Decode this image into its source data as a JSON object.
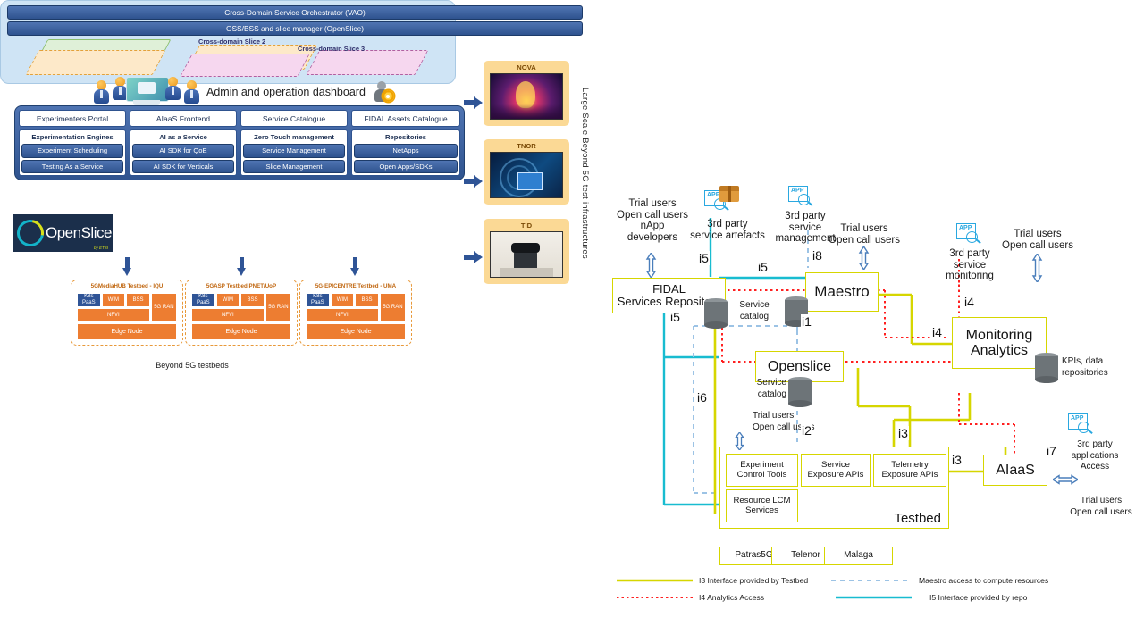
{
  "left_panel": {
    "dashboard_title": "Admin and operation dashboard",
    "top_blocks": [
      {
        "header": "Experimenters Portal",
        "group_title": "Experimentation Engines",
        "items": [
          "Experiment Scheduling",
          "Testing As a Service"
        ]
      },
      {
        "header": "AIaaS Frontend",
        "group_title": "AI as a Service",
        "items": [
          "AI SDK for QoE",
          "AI SDK for Verticals"
        ]
      },
      {
        "header": "Service Catalogue",
        "group_title": "Zero Touch management",
        "items": [
          "Service Management",
          "Slice Management"
        ]
      },
      {
        "header": "FIDAL Assets Catalogue",
        "group_title": "Repositories",
        "items": [
          "NetApps",
          "Open Apps/SDKs"
        ]
      }
    ],
    "orchestrator_bar": "Cross-Domain Service  Orchestrator (VAO)",
    "ossbss_bar": "OSS/BSS and slice manager (OpenSlice)",
    "slice_labels": [
      "Cross-domain Slice 2",
      "Cross-domain Slice 3"
    ],
    "openslice_logo": {
      "text": "OpenSlice",
      "sub": "by ETSI"
    },
    "testbeds": [
      {
        "title": "5GMediaHUB Testbed - IQU",
        "rows": [
          "K8s PaaS",
          "WIM",
          "BSS",
          "5G RAN",
          "NFVI",
          "Edge Node"
        ]
      },
      {
        "title": "5GASP Testbed PNET/UoP",
        "rows": [
          "K8s PaaS",
          "WIM",
          "BSS",
          "5G RAN",
          "NFVI",
          "Edge Node"
        ]
      },
      {
        "title": "5G-EPICENTRE Testbed - UMA",
        "rows": [
          "K8s PaaS",
          "WIM",
          "BSS",
          "5G RAN",
          "NFVI",
          "Edge Node"
        ]
      }
    ],
    "testbeds_caption": "Beyond 5G testbeds",
    "infrastructures": [
      {
        "name": "NOVA"
      },
      {
        "name": "TNOR"
      },
      {
        "name": "TID"
      }
    ],
    "infrastructures_caption": "Large Scale Beyond 5G test infrastructures"
  },
  "right_panel": {
    "boxes": {
      "fidal": "FIDAL\nServices Repository",
      "fidal_l1": "FIDAL",
      "fidal_l2": "Services Repository",
      "maestro": "Maestro",
      "openslice": "Openslice",
      "monitoring_l1": "Monitoring",
      "monitoring_l2": "Analytics",
      "aiaas": "AIaaS",
      "testbed": "Testbed",
      "experiment_control_l1": "Experiment",
      "experiment_control_l2": "Control Tools",
      "service_exposure_l1": "Service",
      "service_exposure_l2": "Exposure APIs",
      "telemetry_l1": "Telemetry",
      "telemetry_l2": "Exposure APIs",
      "resource_lcm_l1": "Resource LCM",
      "resource_lcm_l2": "Services"
    },
    "testbed_sites": [
      "Patras5G",
      "Telenor",
      "Malaga"
    ],
    "actors": [
      {
        "id": "trial-nappdev",
        "lines": [
          "Trial users",
          "Open call users",
          "nApp",
          "developers"
        ],
        "icon": "user-icon"
      },
      {
        "id": "third-party-artefacts",
        "lines": [
          "3rd party",
          "service artefacts"
        ],
        "icon": "app-search-icon"
      },
      {
        "id": "third-party-mgmt",
        "lines": [
          "3rd party",
          "service",
          "management"
        ],
        "icon": "app-search-icon"
      },
      {
        "id": "trial-maestro",
        "lines": [
          "Trial users",
          "Open call users"
        ],
        "icon": "user-icon"
      },
      {
        "id": "third-party-monitoring",
        "lines": [
          "3rd party",
          "service",
          "monitoring"
        ],
        "icon": "app-search-icon"
      },
      {
        "id": "trial-monitoring",
        "lines": [
          "Trial users",
          "Open call users"
        ],
        "icon": "user-icon"
      },
      {
        "id": "trial-openslice",
        "lines": [
          "Trial users",
          "Open call users"
        ],
        "icon": "user-icon"
      },
      {
        "id": "third-party-apps",
        "lines": [
          "3rd party",
          "applications",
          "Access"
        ],
        "icon": "app-search-icon"
      },
      {
        "id": "trial-aiaas",
        "lines": [
          "Trial users",
          "Open call users"
        ],
        "icon": "user-icon"
      }
    ],
    "db_labels": {
      "fidal_service_catalog_l1": "Service",
      "fidal_service_catalog_l2": "catalog",
      "openslice_service_catalog_l1": "Service",
      "openslice_service_catalog_l2": "catalog",
      "kpis_l1": "KPIs, data",
      "kpis_l2": "repositories"
    },
    "interface_labels": [
      "i5",
      "i5",
      "i8",
      "i5",
      "i5",
      "i1",
      "i4",
      "i4",
      "i6",
      "i2",
      "i3",
      "i3",
      "i7"
    ],
    "legend": [
      {
        "style": "solid-yellow",
        "text": "I3 Interface provided by Testbed",
        "color": "#d6d600"
      },
      {
        "style": "dotted-red",
        "text": "I4 Analytics Access",
        "color": "#ff2020"
      },
      {
        "style": "dashed-blue",
        "text": "Maestro access to compute resources",
        "color": "#9cc3e5"
      },
      {
        "style": "solid-cyan",
        "text": "I5 Interface provided by repo",
        "color": "#18bcd0"
      }
    ]
  },
  "colors": {
    "blue_dark": "#2f5496",
    "blue_mid": "#4f74b2",
    "panel_blue": "#cfe4f5",
    "orange": "#ed7d31",
    "amber": "#fbd995",
    "yellow_line": "#d6d600",
    "red_line": "#ff2020",
    "cyan_line": "#18bcd0",
    "dash_blue": "#9cc3e5"
  }
}
